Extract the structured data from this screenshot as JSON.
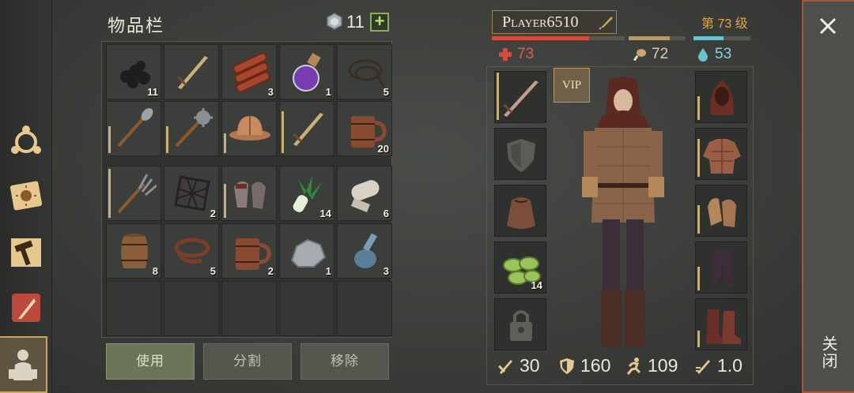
{
  "inventory": {
    "title": "物品栏",
    "gem_count": "11",
    "add_label": "+",
    "items": [
      {
        "name": "coal-icon",
        "qty": "11",
        "durability": null
      },
      {
        "name": "sword-icon",
        "qty": "",
        "durability": null
      },
      {
        "name": "meat-icon",
        "qty": "3",
        "durability": null
      },
      {
        "name": "potion-icon",
        "qty": "1",
        "durability": null
      },
      {
        "name": "rope-icon",
        "qty": "5",
        "durability": null
      },
      {
        "name": "shovel-icon",
        "qty": "",
        "durability": 0.55
      },
      {
        "name": "mace-icon",
        "qty": "",
        "durability": 0.55
      },
      {
        "name": "helmet-icon",
        "qty": "",
        "durability": 0.4
      },
      {
        "name": "sword-icon",
        "qty": "",
        "durability": 0.85
      },
      {
        "name": "mug-icon",
        "qty": "20",
        "durability": null
      },
      {
        "name": "pitchfork-icon",
        "qty": "",
        "durability": 1.0
      },
      {
        "name": "net-icon",
        "qty": "2",
        "durability": null
      },
      {
        "name": "gloves-icon",
        "qty": "",
        "durability": 0.7
      },
      {
        "name": "leek-icon",
        "qty": "14",
        "durability": null
      },
      {
        "name": "cloth-roll-icon",
        "qty": "6",
        "durability": null
      },
      {
        "name": "barrel-icon",
        "qty": "8",
        "durability": null
      },
      {
        "name": "leather-icon",
        "qty": "5",
        "durability": null
      },
      {
        "name": "mug-icon",
        "qty": "2",
        "durability": null
      },
      {
        "name": "stone-icon",
        "qty": "1",
        "durability": null
      },
      {
        "name": "bottle-icon",
        "qty": "3",
        "durability": null
      }
    ],
    "actions": {
      "use": "使用",
      "split": "分割",
      "remove": "移除"
    }
  },
  "player": {
    "name": "Player6510",
    "level": "第 73 级",
    "hp": "73",
    "food": "72",
    "water": "53",
    "hp_fraction": 0.73,
    "food_fraction": 0.72,
    "water_fraction": 0.53,
    "vip_label": "VIP",
    "left_slots": [
      {
        "name": "equipped-sword-icon",
        "qty": "",
        "durability": 1.0
      },
      {
        "name": "shield-slot-icon",
        "qty": "",
        "durability": null
      },
      {
        "name": "bag-icon",
        "qty": "",
        "durability": null
      },
      {
        "name": "beans-icon",
        "qty": "14",
        "durability": null
      },
      {
        "name": "lock-icon",
        "qty": "",
        "durability": null
      }
    ],
    "right_slots": [
      {
        "name": "hood-icon",
        "qty": "",
        "durability": 0.5
      },
      {
        "name": "jacket-icon",
        "qty": "",
        "durability": 0.8
      },
      {
        "name": "work-gloves-icon",
        "qty": "",
        "durability": 0.6
      },
      {
        "name": "pants-icon",
        "qty": "",
        "durability": 0.5
      },
      {
        "name": "boots-icon",
        "qty": "",
        "durability": 0.35
      }
    ],
    "stats": {
      "attack": "30",
      "defense": "160",
      "speed": "109",
      "weight": "1.0"
    }
  },
  "close": {
    "label": "关闭"
  },
  "colors": {
    "hp": "#d84a3c",
    "food": "#b79a6a",
    "water": "#6cc1cf",
    "level": "#e0a648"
  }
}
